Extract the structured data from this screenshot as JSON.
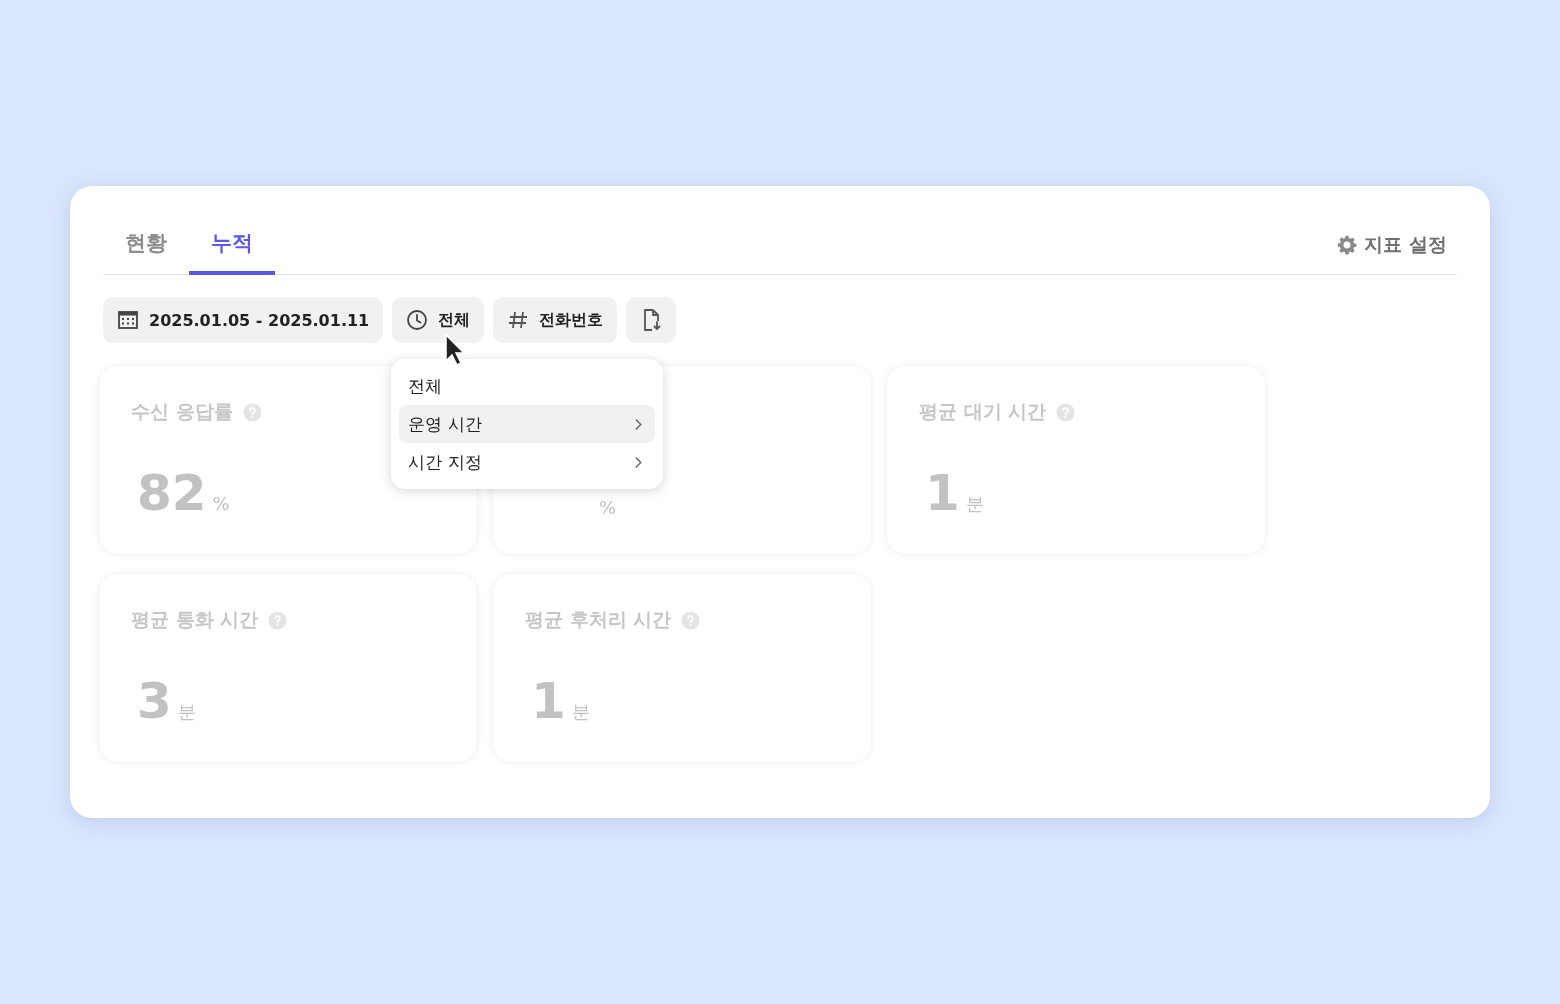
{
  "tabs": [
    {
      "label": "현황",
      "selected": false
    },
    {
      "label": "누적",
      "selected": true
    }
  ],
  "settings_button": {
    "label": "지표 설정"
  },
  "filters": [
    {
      "kind": "date",
      "label": "2025.01.05 - 2025.01.11"
    },
    {
      "kind": "time",
      "label": "전체"
    },
    {
      "kind": "phone",
      "label": "전화번호"
    },
    {
      "kind": "export"
    }
  ],
  "time_menu": {
    "items": [
      {
        "label": "전체",
        "selected": false,
        "has_submenu": false
      },
      {
        "label": "운영 시간",
        "selected": true,
        "has_submenu": true
      },
      {
        "label": "시간 지정",
        "selected": false,
        "has_submenu": true
      }
    ]
  },
  "metrics": [
    {
      "title": "수신 응답률",
      "help": true,
      "value": "82",
      "unit": "%"
    },
    {
      "help": false,
      "unit": "%"
    },
    {
      "title": "평균 대기 시간",
      "help": true,
      "value": "1",
      "unit": "분"
    },
    {
      "title": "평균 통화 시간",
      "help": true,
      "value": "3",
      "unit": "분"
    },
    {
      "title": "평균 후처리 시간",
      "help": true,
      "value": "1",
      "unit": "분"
    }
  ]
}
